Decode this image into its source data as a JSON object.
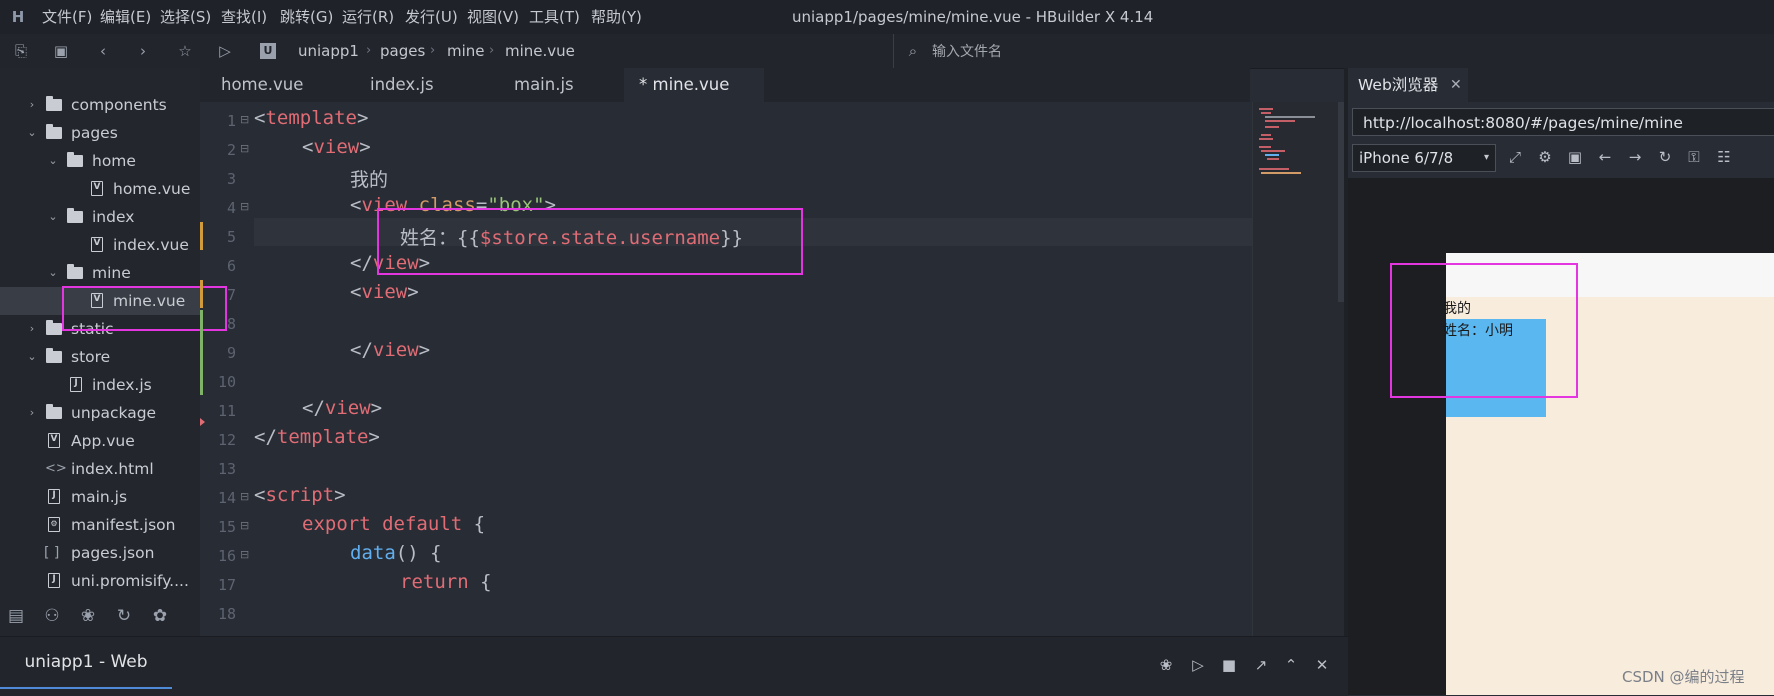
{
  "app": {
    "window_title": "uniapp1/pages/mine/mine.vue - HBuilder X 4.14",
    "menu": [
      "文件(F)",
      "编辑(E)",
      "选择(S)",
      "查找(I)",
      "跳转(G)",
      "运行(R)",
      "发行(U)",
      "视图(V)",
      "工具(T)",
      "帮助(Y)"
    ]
  },
  "toolbar": {
    "breadcrumb": [
      "uniapp1",
      "pages",
      "mine",
      "mine.vue"
    ],
    "file_search_placeholder": "输入文件名"
  },
  "sidebar": {
    "items": [
      {
        "label": "components",
        "kind": "folder",
        "state": "collapsed"
      },
      {
        "label": "pages",
        "kind": "folder",
        "state": "expanded"
      },
      {
        "label": "home",
        "kind": "folder",
        "state": "expanded"
      },
      {
        "label": "home.vue",
        "kind": "vue"
      },
      {
        "label": "index",
        "kind": "folder",
        "state": "expanded"
      },
      {
        "label": "index.vue",
        "kind": "vue"
      },
      {
        "label": "mine",
        "kind": "folder",
        "state": "expanded"
      },
      {
        "label": "mine.vue",
        "kind": "vue",
        "selected": true
      },
      {
        "label": "static",
        "kind": "folder",
        "state": "collapsed"
      },
      {
        "label": "store",
        "kind": "folder",
        "state": "expanded"
      },
      {
        "label": "index.js",
        "kind": "js"
      },
      {
        "label": "unpackage",
        "kind": "folder",
        "state": "collapsed"
      },
      {
        "label": "App.vue",
        "kind": "vue"
      },
      {
        "label": "index.html",
        "kind": "html"
      },
      {
        "label": "main.js",
        "kind": "js"
      },
      {
        "label": "manifest.json",
        "kind": "json-settings"
      },
      {
        "label": "pages.json",
        "kind": "json"
      },
      {
        "label": "uni.promisify....",
        "kind": "js"
      }
    ]
  },
  "editor": {
    "tabs": [
      {
        "label": "home.vue"
      },
      {
        "label": "index.js"
      },
      {
        "label": "main.js"
      },
      {
        "label": "* mine.vue",
        "active": true
      }
    ],
    "line_numbers": [
      "1",
      "2",
      "3",
      "4",
      "5",
      "6",
      "7",
      "8",
      "9",
      "10",
      "11",
      "12",
      "13",
      "14",
      "15",
      "16",
      "17",
      "18"
    ],
    "lines": {
      "l1": {
        "tag": "template"
      },
      "l2": {
        "tag": "view"
      },
      "l3": {
        "text": "我的"
      },
      "l4": {
        "tag": "view",
        "attr": "class",
        "value": "\"box\""
      },
      "l5": {
        "prefix": "姓名：{{",
        "expr": "$store.state.username",
        "suffix": "}}"
      },
      "l6": {
        "tag": "view"
      },
      "l7": {
        "tag": "view"
      },
      "l9": {
        "tag": "view"
      },
      "l11": {
        "tag": "view"
      },
      "l12": {
        "tag": "template"
      },
      "l14": {
        "tag": "script"
      },
      "l15": {
        "kw1": "export",
        "kw2": "default",
        "brace": "{"
      },
      "l16": {
        "fn": "data",
        "rest": "() {"
      },
      "l17": {
        "kw": "return",
        "brace": "{"
      }
    }
  },
  "preview": {
    "tab_label": "Web浏览器",
    "url": "http://localhost:8080/#/pages/mine/mine",
    "device": "iPhone 6/7/8",
    "content": {
      "title_text": "我的",
      "name_text": "姓名：小明"
    }
  },
  "bottom": {
    "console_tab": "uniapp1 - Web"
  },
  "watermark": "CSDN @编的过程",
  "colors": {
    "highlight_box": "#e335e0",
    "accent": "#4e8ad6",
    "preview_blue": "#5ab7f0"
  }
}
